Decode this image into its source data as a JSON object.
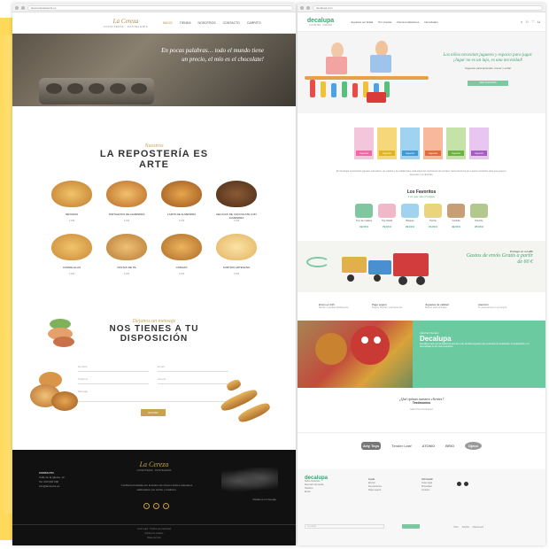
{
  "left": {
    "url": "lacerezapasteleria.es",
    "logo": {
      "title": "La Cereza",
      "subtitle": "CONFITERIA · PASTELERÍA"
    },
    "menu": [
      "INICIO",
      "TIENDA",
      "NOSOTROS",
      "CONTACTO",
      "CARRITO"
    ],
    "hero_quote": "En pocas palabras… todo el mundo tiene un precio, el mío es el chocolate!",
    "section_script": "Nuestros",
    "section_title_1": "LA REPOSTERÍA ES",
    "section_title_2": "ARTE",
    "products": [
      {
        "name": "NEVADAS",
        "price": "0,00€"
      },
      {
        "name": "TARTALETAS DE ALMENDRA",
        "price": "0,00€"
      },
      {
        "name": "LAZOS DE ALMENDRA",
        "price": "0,00€"
      },
      {
        "name": "DELICIAS DE CHOCOLATE CON ALMENDRA",
        "price": "0,00€"
      },
      {
        "name": "CANDELILLAS",
        "price": "0,00€"
      },
      {
        "name": "PASTAS DE TÉ",
        "price": "0,00€"
      },
      {
        "name": "CORAZÓ",
        "price": "0,00€"
      },
      {
        "name": "SURTIDO ARTESANO",
        "price": "0,00€"
      }
    ],
    "contact_script": "Déjanos un mensaje",
    "contact_title_1": "NOS TIENES A TU",
    "contact_title_2": "DISPOSICIÓN",
    "form": {
      "name": "Nombre",
      "email": "Email",
      "phone": "Teléfono",
      "subject": "Asunto",
      "message": "Mensaje",
      "send": "ENVIAR"
    },
    "footer": {
      "logo_title": "La Cereza",
      "logo_subtitle": "CONFITERIA · PASTELERÍA",
      "contact_head": "CONTACTO",
      "contact_lines": [
        "Calle de la Iglesia, 12",
        "Tel. 000 000 000",
        "info@lacereza.es"
      ],
      "about": "Confitería fundada con la ilusión de ofrecer dulces artesanos elaborados con cariño y tradición.",
      "map_label": "Visítanos en Google",
      "social": [
        "f",
        "t",
        "i"
      ],
      "bottom": [
        "Aviso legal · Política de privacidad",
        "Política de cookies",
        "Mapa del sitio"
      ]
    }
  },
  "right": {
    "url": "decalupa.com",
    "logo": {
      "title": "decalupa",
      "subtitle": "JUGUETES · ALEGRÍA"
    },
    "menu": [
      "Juguetes por Edad",
      "Por marcas",
      "Recomendaciones",
      "Novedades"
    ],
    "icons": [
      "search-icon",
      "user-icon",
      "heart-icon",
      "cart-icon"
    ],
    "hero_script": "Los niños necesitan juguetes y espacio para jugar. ¡Jugar no es un lujo, es una necesidad!",
    "hero_p": "Juguetes para aprender, crecer y soñar",
    "hero_btn": "VER JUGUETES",
    "categories": [
      "Juguetes",
      "Juguetes",
      "Juguetes",
      "Juguetes",
      "Juguetes",
      "Juguetes"
    ],
    "cat_colors": [
      "#f3c6dc",
      "#f6d87a",
      "#9fd3f0",
      "#f7b89b",
      "#c5e3a8",
      "#e9c6f0"
    ],
    "intro": "En Decalupa encontrarás juguetes educativos, de madera y de calidad para cada etapa del crecimiento de tus hijos. Seleccionamos los mejores productos para que jueguen, aprendan y se diviertan.",
    "fav_title": "Los Favoritos",
    "fav_script": "Los que más triunfan",
    "favs": [
      {
        "n": "Tren de madera",
        "pr": "19,00 €",
        "c": "#7fc7a1"
      },
      {
        "n": "Tipi infantil",
        "pr": "79,00 €",
        "c": "#f1b8c9"
      },
      {
        "n": "Bloques",
        "pr": "29,00 €",
        "c": "#9fd3f0"
      },
      {
        "n": "Puzzle",
        "pr": "15,00 €",
        "c": "#e9d57c"
      },
      {
        "n": "Cocinita",
        "pr": "49,00 €",
        "c": "#c89f74"
      },
      {
        "n": "Peluche",
        "pr": "25,00 €",
        "c": "#b2c98d"
      }
    ],
    "promo_a": "Entrega en 24-48h",
    "promo_b": "Gastos de envío Gratis a partir de 60 €",
    "features": [
      {
        "h": "Envío en 24h",
        "d": "Recibe tu pedido rápidamente"
      },
      {
        "h": "Pago seguro",
        "d": "Tarjeta, PayPal y transferencia"
      },
      {
        "h": "Juguetes de calidad",
        "d": "Marcas seleccionadas"
      },
      {
        "h": "Atención",
        "d": "Te asesoramos en tu compra"
      }
    ],
    "about_script": "Quiénes Somos",
    "about_title": "Decalupa",
    "about_text": "Decalupa nace con la ilusión de acercar a las familias juguetes que estimulen la creatividad, la imaginación y el aprendizaje de los más pequeños.",
    "testi_q": "¿Qué opinan nuestros clientes?",
    "testi_s": "Testimonios",
    "testi_p": "Isabel Pérez Rodríguez",
    "brands": [
      "Arty Toys",
      "Tender Leaf",
      "ATOMO",
      "BRIO",
      "Djeco"
    ],
    "footer": {
      "logo": "decalupa",
      "col1": [
        "Sobre Nosotros",
        "Dirección de tienda",
        "Teléfono",
        "Email"
      ],
      "col2_head": "Ayuda",
      "col2": [
        "Envíos",
        "Devoluciones",
        "Pago seguro"
      ],
      "col3_head": "Información",
      "col3": [
        "Aviso legal",
        "Privacidad",
        "Cookies"
      ],
      "news": "Tu email",
      "pay": [
        "VISA",
        "PayPal",
        "Mastercard"
      ]
    }
  }
}
